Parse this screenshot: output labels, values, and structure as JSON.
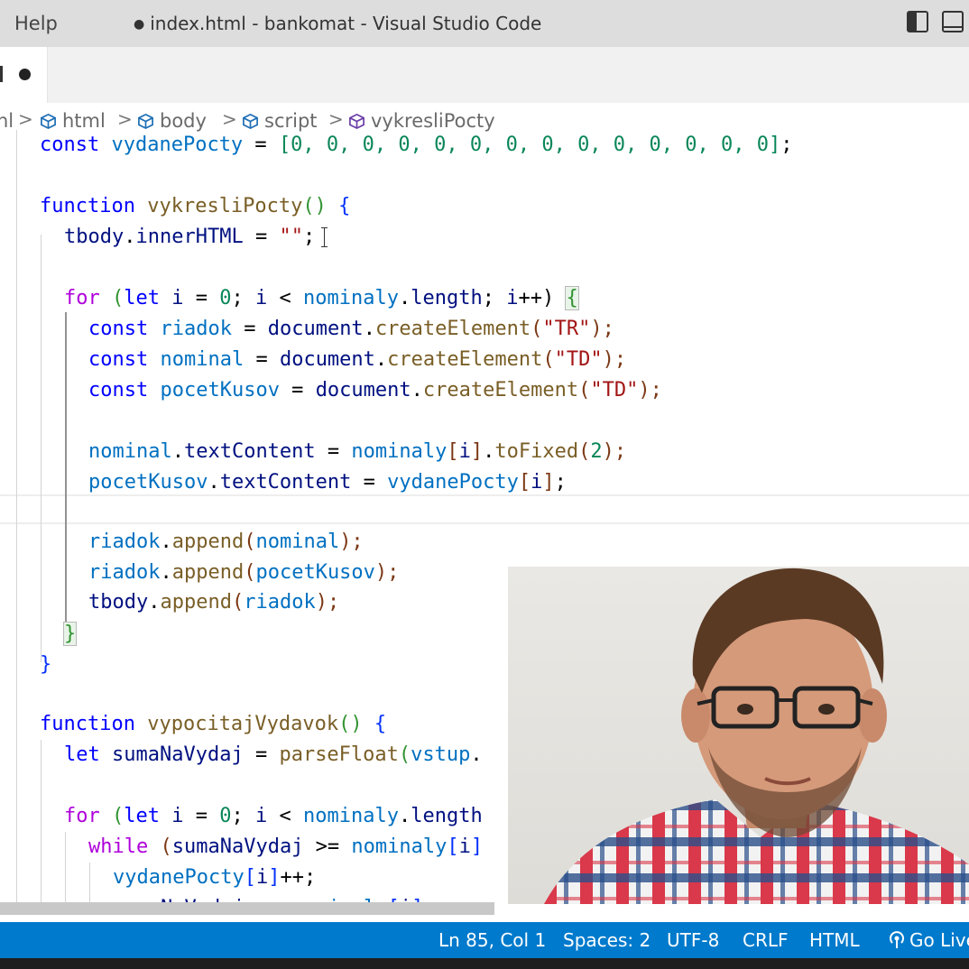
{
  "titlebar": {
    "menu_help": "Help",
    "title": "index.html - bankomat - Visual Studio Code",
    "modified_dot": "●"
  },
  "breadcrumb": {
    "partial_first": "nl",
    "items": [
      "html",
      "body",
      "script",
      "vykresliPocty"
    ],
    "separator": ">"
  },
  "code": {
    "l0": {
      "kw": "const",
      "v": "vydanePocty",
      "eq": " = ",
      "arr": "[0, 0, 0, 0, 0, 0, 0, 0, 0, 0, 0, 0, 0, 0]",
      "end": ";"
    },
    "l2": {
      "kw": "function",
      "fn": "vykresliPocty",
      "p": "()",
      "b": "{"
    },
    "l3": {
      "v": "tbody",
      "dot": ".",
      "prop": "innerHTML",
      "eq": " = ",
      "s": "\"\"",
      "end": ";"
    },
    "l5": {
      "kw": "for",
      "p1": " (",
      "kw2": "let",
      "v": "i",
      "eq": " = ",
      "n": "0",
      "s1": "; ",
      "v2": "i",
      "lt": " < ",
      "v3": "nominaly",
      "dot": ".",
      "prop": "length",
      "s2": "; ",
      "v4": "i",
      "inc": "++)",
      "sp": " ",
      "b": "{"
    },
    "l6": {
      "kw": "const",
      "v": "riadok",
      "eq": " = ",
      "obj": "document",
      "dot": ".",
      "fn": "createElement",
      "p1": "(",
      "s": "\"TR\"",
      "p2": ");"
    },
    "l7": {
      "kw": "const",
      "v": "nominal",
      "eq": " = ",
      "obj": "document",
      "dot": ".",
      "fn": "createElement",
      "p1": "(",
      "s": "\"TD\"",
      "p2": ");"
    },
    "l8": {
      "kw": "const",
      "v": "pocetKusov",
      "eq": " = ",
      "obj": "document",
      "dot": ".",
      "fn": "createElement",
      "p1": "(",
      "s": "\"TD\"",
      "p2": ");"
    },
    "l10": {
      "v": "nominal",
      "dot": ".",
      "prop": "textContent",
      "eq": " = ",
      "v2": "nominaly",
      "br": "[",
      "i": "i",
      "br2": "]",
      "dot2": ".",
      "fn": "toFixed",
      "p1": "(",
      "n": "2",
      "p2": ");"
    },
    "l11": {
      "v": "pocetKusov",
      "dot": ".",
      "prop": "textContent",
      "eq": " = ",
      "v2": "vydanePocty",
      "br": "[",
      "i": "i",
      "br2": "]",
      "end": ";"
    },
    "l13": {
      "v": "riadok",
      "dot": ".",
      "fn": "append",
      "p1": "(",
      "a": "nominal",
      "p2": ");"
    },
    "l14": {
      "v": "riadok",
      "dot": ".",
      "fn": "append",
      "p1": "(",
      "a": "pocetKusov",
      "p2": ");"
    },
    "l15": {
      "v": "tbody",
      "dot": ".",
      "fn": "append",
      "p1": "(",
      "a": "riadok",
      "p2": ");"
    },
    "l16": {
      "b": "}"
    },
    "l17": {
      "b": "}"
    },
    "l19": {
      "kw": "function",
      "fn": "vypocitajVydavok",
      "p": "()",
      "b": "{"
    },
    "l20": {
      "kw": "let",
      "v": "sumaNaVydaj",
      "eq": " = ",
      "fn": "parseFloat",
      "p1": "(",
      "v2": "vstup",
      "dot": "."
    },
    "l22": {
      "kw": "for",
      "p1": " (",
      "kw2": "let",
      "v": "i",
      "eq": " = ",
      "n": "0",
      "s1": "; ",
      "v2": "i",
      "lt": " < ",
      "v3": "nominaly",
      "dot": ".",
      "prop": "length"
    },
    "l23": {
      "kw": "while",
      "p1": " (",
      "v": "sumaNaVydaj",
      "ge": " >= ",
      "v2": "nominaly",
      "br": "[",
      "i": "i",
      "br2": "]"
    },
    "l24": {
      "v": "vydanePocty",
      "br": "[",
      "i": "i",
      "br2": "]",
      "inc": "++;"
    },
    "l25": {
      "v": "sumaNaVydaj",
      "op": " -= ",
      "v2": "nominaly",
      "br": "[",
      "i": "i",
      "br2": "]",
      "end": ";"
    }
  },
  "statusbar": {
    "position": "Ln 85, Col 1",
    "spaces": "Spaces: 2",
    "encoding": "UTF-8",
    "eol": "CRLF",
    "language": "HTML",
    "golive": "Go Live"
  },
  "colors": {
    "statusbar": "#007acc",
    "keyword": "#0000ff",
    "function": "#795e26",
    "variable": "#001080",
    "string": "#a31515",
    "number": "#098658"
  }
}
